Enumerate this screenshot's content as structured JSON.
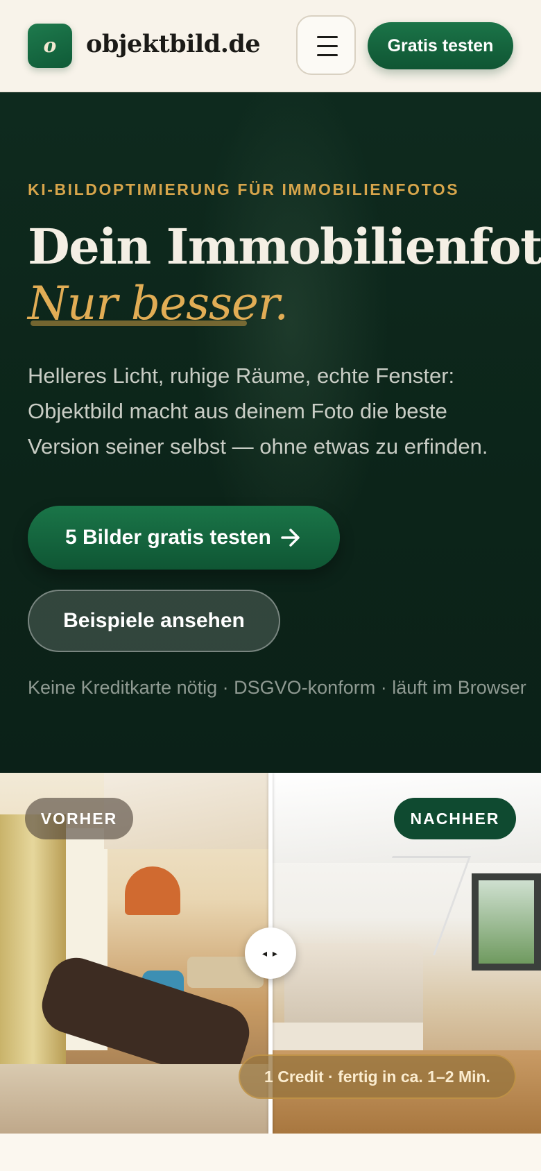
{
  "header": {
    "logo_mark": "o",
    "logo_text": "objektbild.de",
    "menu_icon": "hamburger-icon",
    "cta_label": "Gratis testen"
  },
  "hero": {
    "eyebrow": "KI-BILDOPTIMIERUNG FÜR IMMOBILIENFOTOS",
    "headline_line1": "Dein Immobilienfoto.",
    "headline_line2": "Nur besser.",
    "subtext": "Helleres Licht, ruhige Räume, echte Fenster: Objektbild macht aus deinem Foto die beste Version seiner selbst — ohne etwas zu erfinden.",
    "primary_cta": "5 Bilder gratis testen",
    "primary_cta_icon": "arrow-right-icon",
    "secondary_cta": "Beispiele ansehen",
    "trust_line": "Keine Kreditkarte nötig · DSGVO-konform · läuft im Browser"
  },
  "compare": {
    "before_label": "VORHER",
    "after_label": "NACHHER",
    "handle_glyph": "◂ ▸",
    "credit_note": "1 Credit · fertig in ca. 1–2 Min."
  },
  "colors": {
    "brand_green": "#0f5634",
    "hero_bg": "#0c2419",
    "accent_gold": "#d7a54b",
    "page_bg": "#fbf7ef"
  }
}
